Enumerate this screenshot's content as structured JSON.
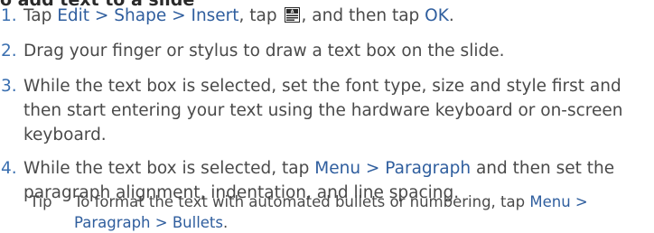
{
  "section_heading": "o add text to a slide",
  "steps": [
    {
      "number": "1.",
      "parts": {
        "pre": "Tap ",
        "menu_path": "Edit > Shape > Insert",
        "mid": ", tap ",
        "icon": "text-box-icon",
        "post": ", and then tap ",
        "ok": "OK",
        "end": "."
      }
    },
    {
      "number": "2.",
      "text": "Drag your finger or stylus to draw a text box on the slide."
    },
    {
      "number": "3.",
      "text": "While the text box is selected, set the font type, size and style first and then start entering your text using the hardware keyboard or on-screen keyboard."
    },
    {
      "number": "4.",
      "parts": {
        "pre": "While the text box is selected, tap ",
        "menu_path": "Menu > Paragraph",
        "post": " and then set the paragraph alignment, indentation, and line spacing."
      }
    }
  ],
  "tip": {
    "label": "Tip",
    "pre": "To format the text with automated bullets or numbering, tap ",
    "menu_path": "Menu > Paragraph > Bullets",
    "end": "."
  },
  "colors": {
    "highlight": "#2f5e9e",
    "body_text": "#4a4a4a"
  }
}
